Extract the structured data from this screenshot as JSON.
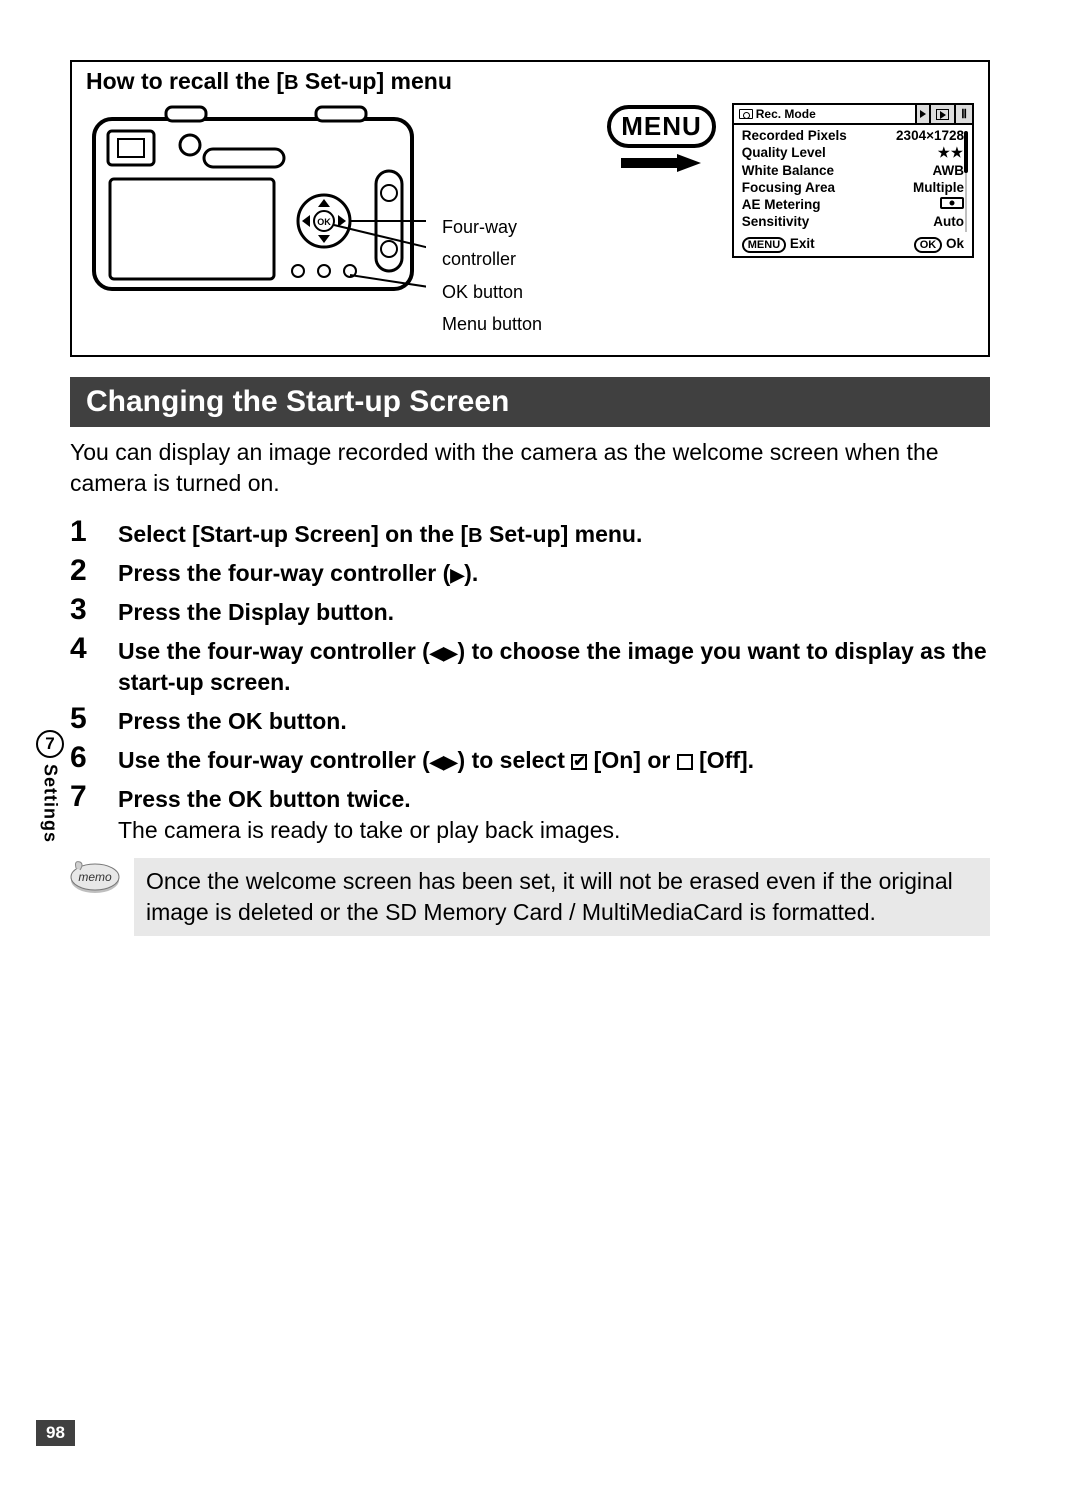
{
  "recall": {
    "title_pre": "How to recall the [",
    "title_post": " Set-up] menu",
    "setup_icon_glyph": "Ⅱ",
    "label1": "Four-way controller",
    "label2": "OK button",
    "label3": "Menu button",
    "menu_button_label": "MENU"
  },
  "menu_screen": {
    "tab_rec": "Rec. Mode",
    "rows": [
      {
        "k": "Recorded Pixels",
        "v": "2304×1728"
      },
      {
        "k": "Quality Level",
        "v": "★★"
      },
      {
        "k": "White Balance",
        "v": "AWB"
      },
      {
        "k": "Focusing Area",
        "v": "Multiple"
      },
      {
        "k": "AE Metering",
        "v": "__metering__"
      },
      {
        "k": "Sensitivity",
        "v": "Auto"
      }
    ],
    "footer_left_kbd": "MENU",
    "footer_left": "Exit",
    "footer_right_kbd": "OK",
    "footer_right": "Ok"
  },
  "section_title": "Changing the Start-up Screen",
  "intro": "You can display an image recorded with the camera as the welcome screen when the camera is turned on.",
  "steps": [
    {
      "n": "1",
      "t_pre": "Select [Start-up Screen] on the [",
      "t_post": " Set-up] menu.",
      "has_setup_icon": true
    },
    {
      "n": "2",
      "t_pre": "Press the four-way controller (",
      "t_tri": "▶",
      "t_post": ")."
    },
    {
      "n": "3",
      "t_pre": "Press the Display button."
    },
    {
      "n": "4",
      "t_pre": "Use the four-way controller (",
      "t_tri": "◀▶",
      "t_post": ") to choose the image you want to display as the start-up screen."
    },
    {
      "n": "5",
      "t_pre": "Press the OK button."
    },
    {
      "n": "6",
      "t_pre": "Use the four-way controller (",
      "t_tri": "◀▶",
      "t_post": ") to select ",
      "t_after_check_on": " [On] or ",
      "t_after_check_off": " [Off].",
      "has_checkboxes": true
    },
    {
      "n": "7",
      "t_pre": "Press the OK button twice."
    }
  ],
  "after_steps": "The camera is ready to take or play back images.",
  "memo": {
    "label": "memo",
    "text": "Once the welcome screen has been set, it will not be erased even if the original image is deleted or the SD Memory Card / MultiMediaCard is formatted."
  },
  "side": {
    "chapter": "7",
    "label": "Settings"
  },
  "page_number": "98"
}
